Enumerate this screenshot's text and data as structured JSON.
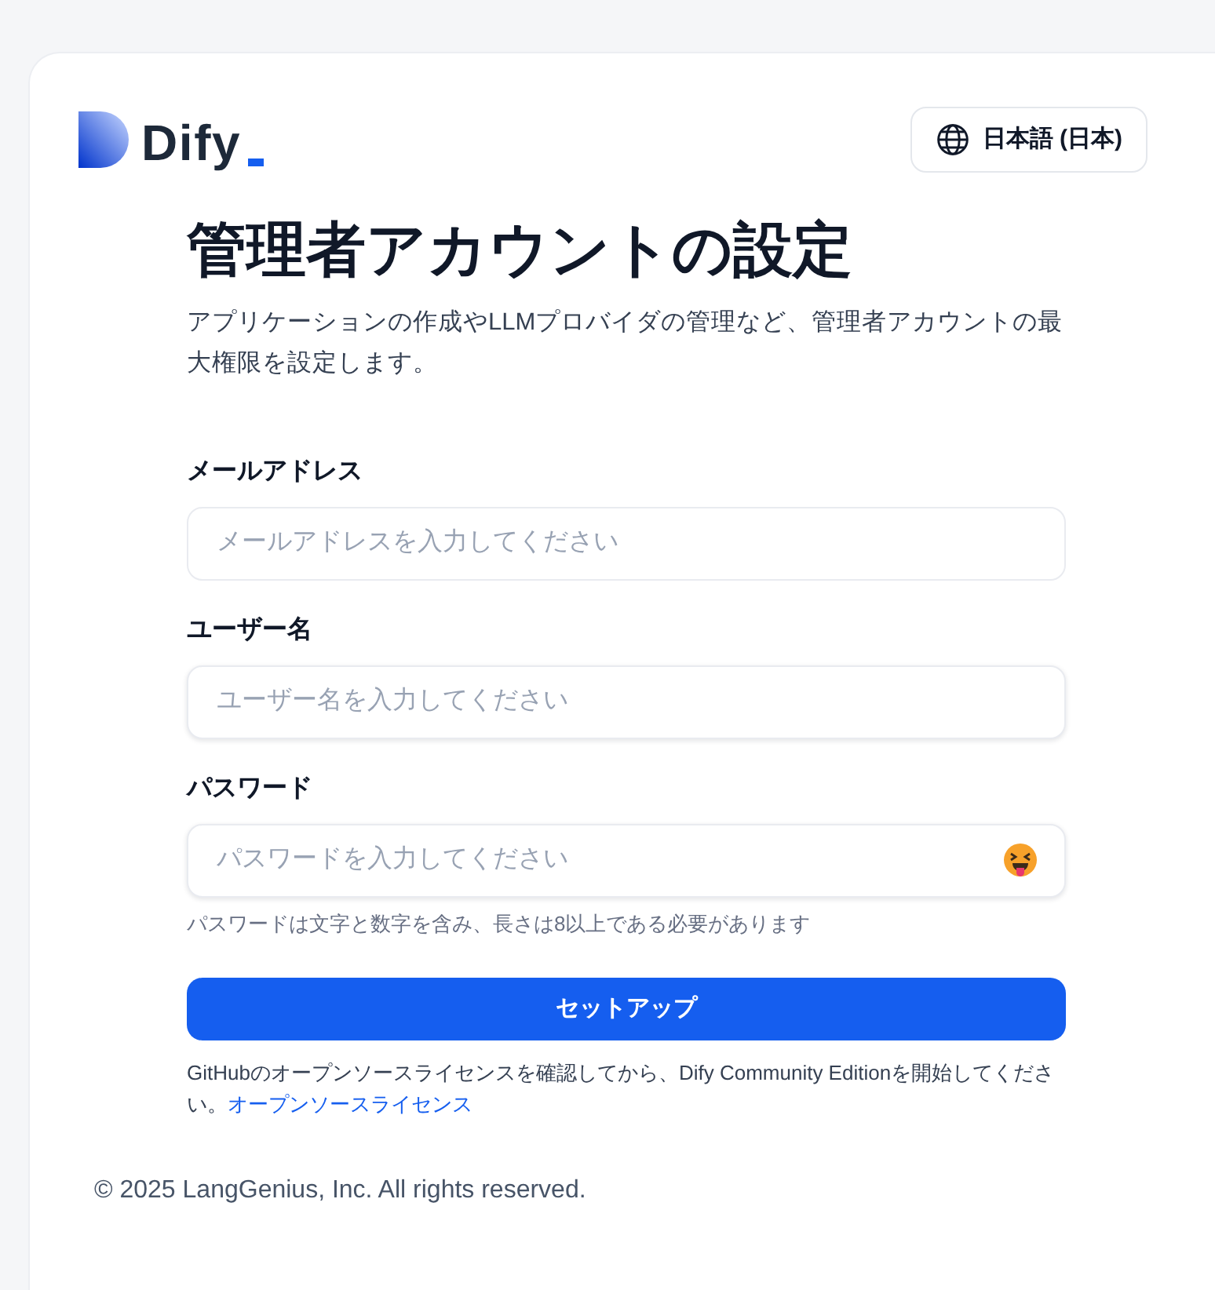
{
  "logo": {
    "text": "Dify"
  },
  "language_button": {
    "label": "日本語 (日本)"
  },
  "title": "管理者アカウントの設定",
  "subtitle": "アプリケーションの作成やLLMプロバイダの管理など、管理者アカウントの最大権限を設定します。",
  "fields": [
    {
      "kind": "email",
      "label": "メールアドレス",
      "placeholder": "メールアドレスを入力してください"
    },
    {
      "kind": "text",
      "label": "ユーザー名",
      "placeholder": "ユーザー名を入力してください"
    },
    {
      "kind": "password",
      "label": "パスワード",
      "placeholder": "パスワードを入力してください",
      "hint": "パスワードは文字と数字を含み、長さは8以上である必要があります"
    }
  ],
  "submit_button": "セットアップ",
  "license_note": {
    "text": "GitHubのオープンソースライセンスを確認してから、Dify Community Editionを開始してください。",
    "link": "オープンソースライセンス"
  },
  "copyright": "© 2025 LangGenius, Inc. All rights reserved."
}
